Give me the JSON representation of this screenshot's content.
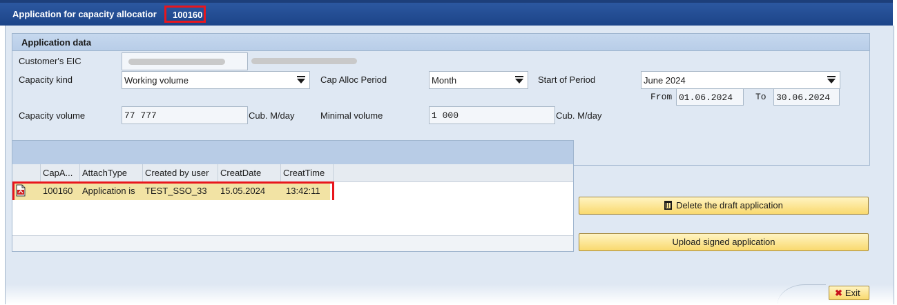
{
  "window": {
    "title": "Application for capacity allocatior",
    "application_number": "100160"
  },
  "application_data": {
    "group_title": "Application data",
    "customer_eic_label": "Customer's EIC",
    "capacity_kind_label": "Capacity kind",
    "capacity_kind_value": "Working volume",
    "cap_alloc_period_label": "Cap Alloc Period",
    "cap_alloc_period_value": "Month",
    "start_of_period_label": "Start of Period",
    "start_of_period_value": "June 2024",
    "from_label": "From",
    "from_value": "01.06.2024",
    "to_label": "To",
    "to_value": "30.06.2024",
    "capacity_volume_label": "Capacity volume",
    "capacity_volume_value": "77 777",
    "capacity_volume_unit": "Cub. M/day",
    "minimal_volume_label": "Minimal volume",
    "minimal_volume_value": "1 000",
    "minimal_volume_unit": "Cub. M/day"
  },
  "table": {
    "columns": [
      "CapA...",
      "AttachType",
      "Created by user",
      "CreatDate",
      "CreatTime"
    ],
    "rows": [
      {
        "icon": "pdf-document-icon",
        "cap_a": "100160",
        "attach_type": "Application is",
        "created_by": "TEST_SSO_33",
        "creat_date": "15.05.2024",
        "creat_time": "13:42:11"
      }
    ]
  },
  "actions": {
    "delete_draft_label": "Delete the draft application",
    "upload_signed_label": "Upload signed application",
    "exit_label": "Exit"
  },
  "colors": {
    "titlebar": "#1c4488",
    "highlight_border": "#e8161d",
    "selected_row": "#f2e3a4",
    "button_face": "#f9d96e"
  }
}
